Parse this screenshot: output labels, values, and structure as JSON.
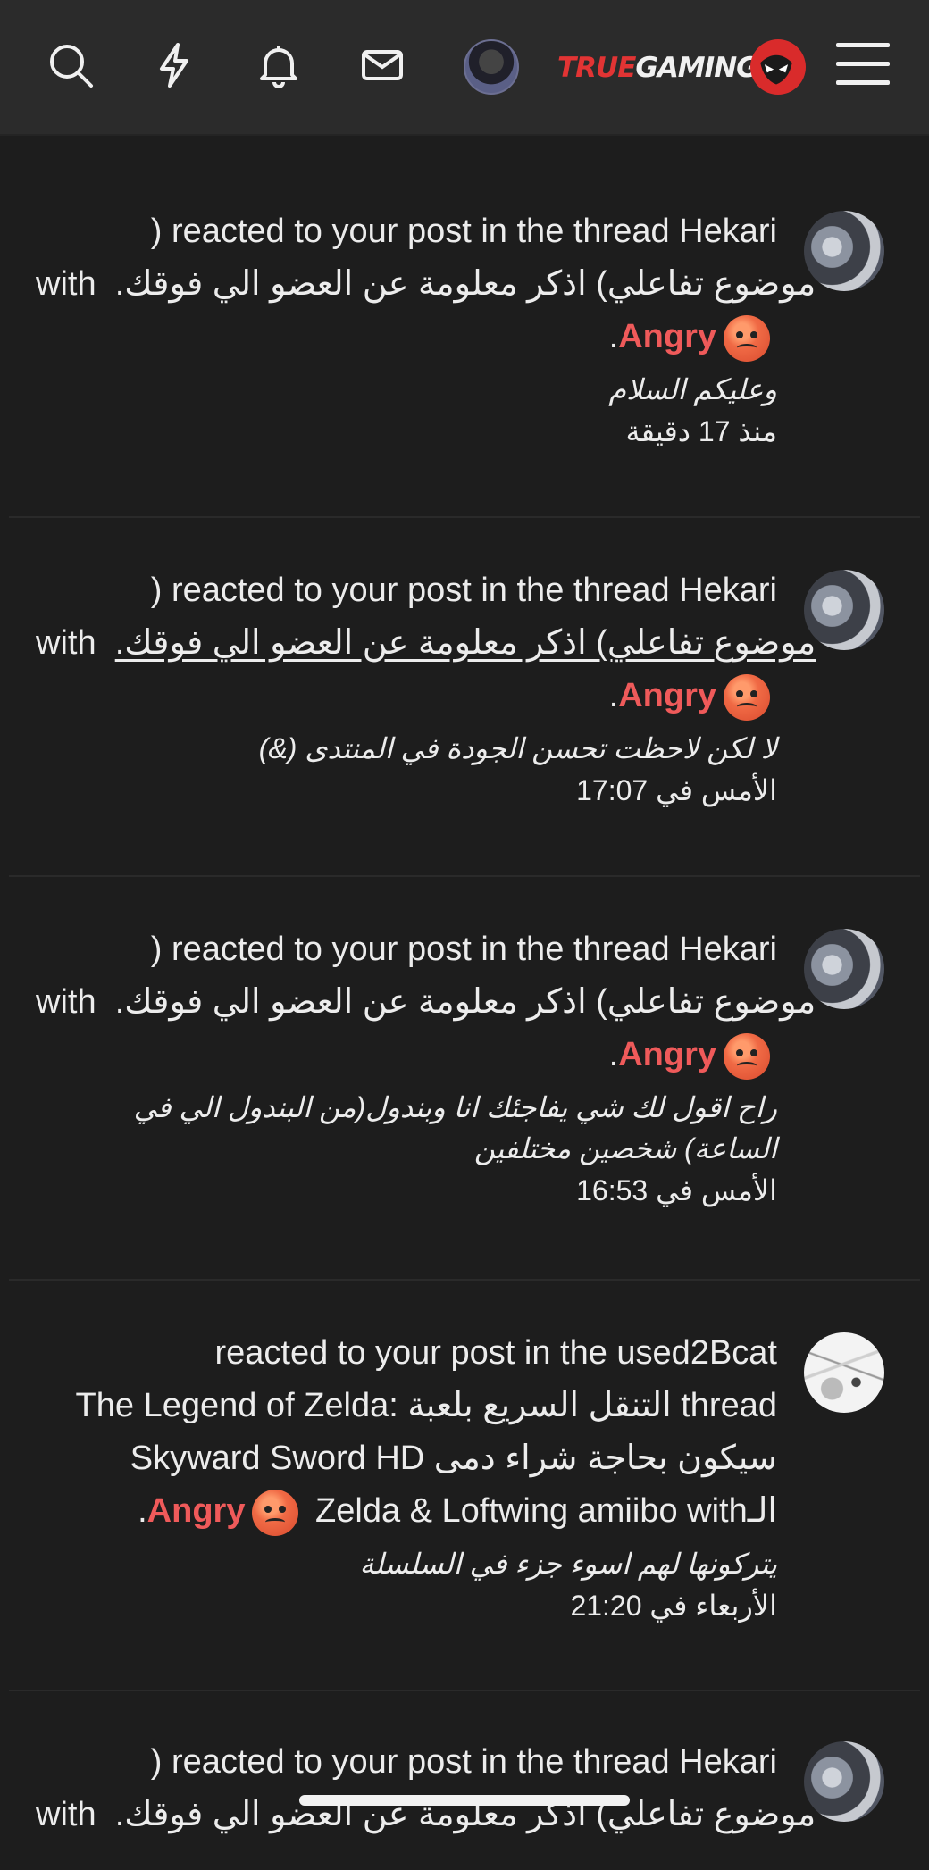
{
  "header": {
    "icons": [
      "search-icon",
      "lightning-icon",
      "bell-icon",
      "mail-icon"
    ],
    "logo_part1": "TRUE",
    "logo_part2": "GAMING"
  },
  "notifications": [
    {
      "line1": ") reacted to your post in the thread Hekari",
      "line2": "موضوع تفاعلي) اذكر معلومة عن العضو الي فوقك.",
      "with": "with",
      "reaction": "Angry",
      "period": ".",
      "snippet": "وعليكم السلام",
      "time": "منذ 17 دقيقة"
    },
    {
      "line1": ") reacted to your post in the thread Hekari",
      "line2": "موضوع تفاعلي) اذكر معلومة عن العضو الي فوقك.",
      "with": "with",
      "reaction": "Angry",
      "period": ".",
      "snippet": "لا لكن لاحظت تحسن الجودة في المنتدى (&)",
      "time": "الأمس في 17:07"
    },
    {
      "line1": ") reacted to your post in the thread Hekari",
      "line2": "موضوع تفاعلي) اذكر معلومة عن العضو الي فوقك.",
      "with": "with",
      "reaction": "Angry",
      "period": ".",
      "snippet": "راح اقول لك شي يفاجئك انا وبندول(من البندول الي في الساعة) شخصين مختلفين",
      "time": "الأمس في 16:53"
    },
    {
      "line1": "reacted to your post in the used2Bcat",
      "line2": "The Legend of Zelda: التنقل السريع بلعبة thread",
      "line3": "Skyward Sword HD سيكون بحاجة شراء دمى",
      "line4": "Zelda & Loftwing amiibo withالـ",
      "reaction": "Angry",
      "period": ".",
      "snippet": "يتركونها لهم اسوء جزء في السلسلة",
      "time": "الأربعاء في 21:20"
    },
    {
      "line1": ") reacted to your post in the thread Hekari",
      "line2": "موضوع تفاعلي) اذكر معلومة عن العضو الي فوقك.",
      "with": "with"
    }
  ],
  "colors": {
    "accent": "#ef5a5a",
    "background": "#1d1d1d",
    "header": "#2b2b2b"
  }
}
